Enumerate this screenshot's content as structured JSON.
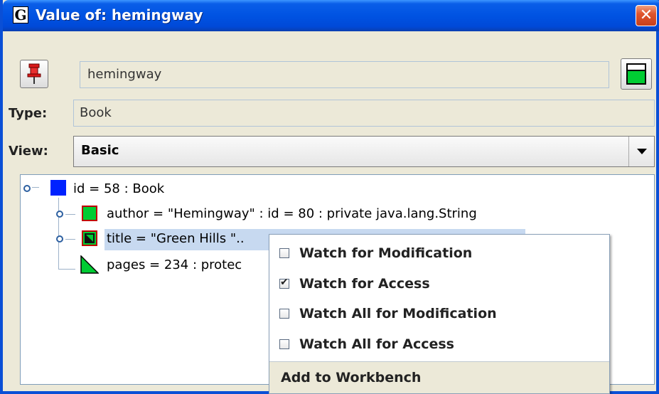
{
  "window": {
    "title": "Value of: hemingway",
    "app_icon_glyph": "G",
    "close_icon": "close-icon"
  },
  "toolbar": {
    "pin_icon": "pin-icon",
    "name_value": "hemingway",
    "color_icon": "color-swatch-icon"
  },
  "type_row": {
    "label": "Type:",
    "value": "Book"
  },
  "view_row": {
    "label": "View:",
    "value": "Basic"
  },
  "tree": {
    "nodes": [
      {
        "text": "id = 58 : Book",
        "icon": "blue-square-icon",
        "color": "#0022ff"
      },
      {
        "text": "author = \"Hemingway\" : id = 80 : private java.lang.String",
        "icon": "green-square-icon",
        "color": "#00cc33"
      },
      {
        "text": "title = \"Green Hills \"..",
        "icon": "watched-field-icon",
        "color": "#00cc33"
      },
      {
        "text": "pages = 234 : protec",
        "icon": "primitive-triangle-icon",
        "color": "#00cc33"
      }
    ]
  },
  "context_menu": {
    "items": [
      {
        "label": "Watch for Modification",
        "checked": false
      },
      {
        "label": "Watch for Access",
        "checked": true
      },
      {
        "label": "Watch All for Modification",
        "checked": false
      },
      {
        "label": "Watch All for Access",
        "checked": false
      }
    ],
    "workbench_label": "Add to Workbench"
  }
}
